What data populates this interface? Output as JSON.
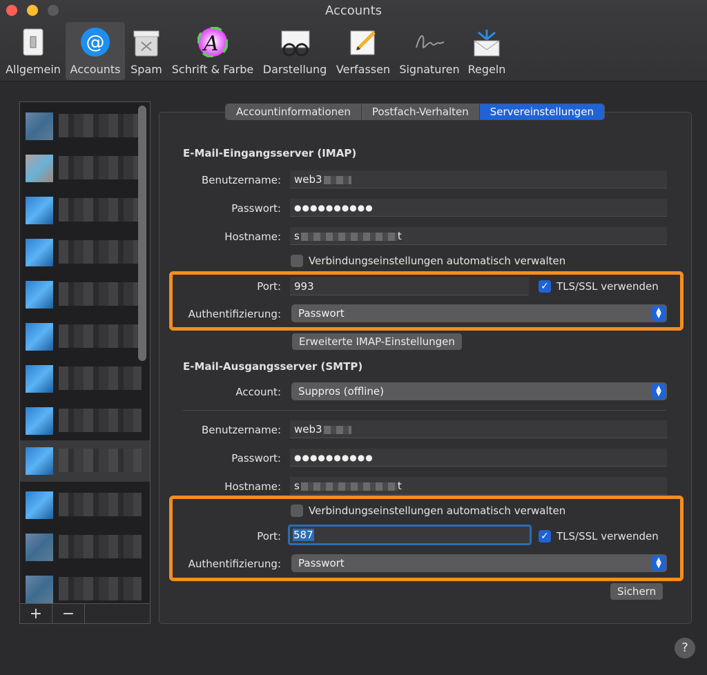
{
  "window": {
    "title": "Accounts"
  },
  "toolbar": {
    "items": [
      {
        "label": "Allgemein",
        "icon": "switch-icon"
      },
      {
        "label": "Accounts",
        "icon": "at-sign-icon"
      },
      {
        "label": "Spam",
        "icon": "trash-bin-icon"
      },
      {
        "label": "Schrift & Farbe",
        "icon": "font-color-icon"
      },
      {
        "label": "Darstellung",
        "icon": "glasses-icon"
      },
      {
        "label": "Verfassen",
        "icon": "pencil-icon"
      },
      {
        "label": "Signaturen",
        "icon": "signature-icon"
      },
      {
        "label": "Regeln",
        "icon": "envelope-arrows-icon"
      }
    ],
    "active": "Accounts"
  },
  "sidebar": {
    "add_label": "+",
    "remove_label": "−"
  },
  "tabs": {
    "items": [
      "Accountinformationen",
      "Postfach-Verhalten",
      "Servereinstellungen"
    ],
    "active": "Servereinstellungen"
  },
  "imap": {
    "section_title": "E-Mail-Eingangsserver (IMAP)",
    "username_label": "Benutzername:",
    "username_value": "web3",
    "password_label": "Passwort:",
    "password_value": "●●●●●●●●●●",
    "hostname_label": "Hostname:",
    "hostname_value": "s",
    "hostname_suffix": "t",
    "auto_manage_label": "Verbindungseinstellungen automatisch verwalten",
    "port_label": "Port:",
    "port_value": "993",
    "tls_label": "TLS/SSL verwenden",
    "auth_label": "Authentifizierung:",
    "auth_value": "Passwort",
    "advanced_button": "Erweiterte IMAP-Einstellungen"
  },
  "smtp": {
    "section_title": "E-Mail-Ausgangsserver (SMTP)",
    "account_label": "Account:",
    "account_value": "Suppros (offline)",
    "username_label": "Benutzername:",
    "username_value": "web3",
    "password_label": "Passwort:",
    "password_value": "●●●●●●●●●●",
    "hostname_label": "Hostname:",
    "hostname_value": "s",
    "hostname_suffix": "t",
    "auto_manage_label": "Verbindungseinstellungen automatisch verwalten",
    "port_label": "Port:",
    "port_value": "587",
    "tls_label": "TLS/SSL verwenden",
    "auth_label": "Authentifizierung:",
    "auth_value": "Passwort"
  },
  "save_button": "Sichern",
  "help_button": "?",
  "colors": {
    "accent": "#1f63d6",
    "highlight": "#f78d1e"
  }
}
